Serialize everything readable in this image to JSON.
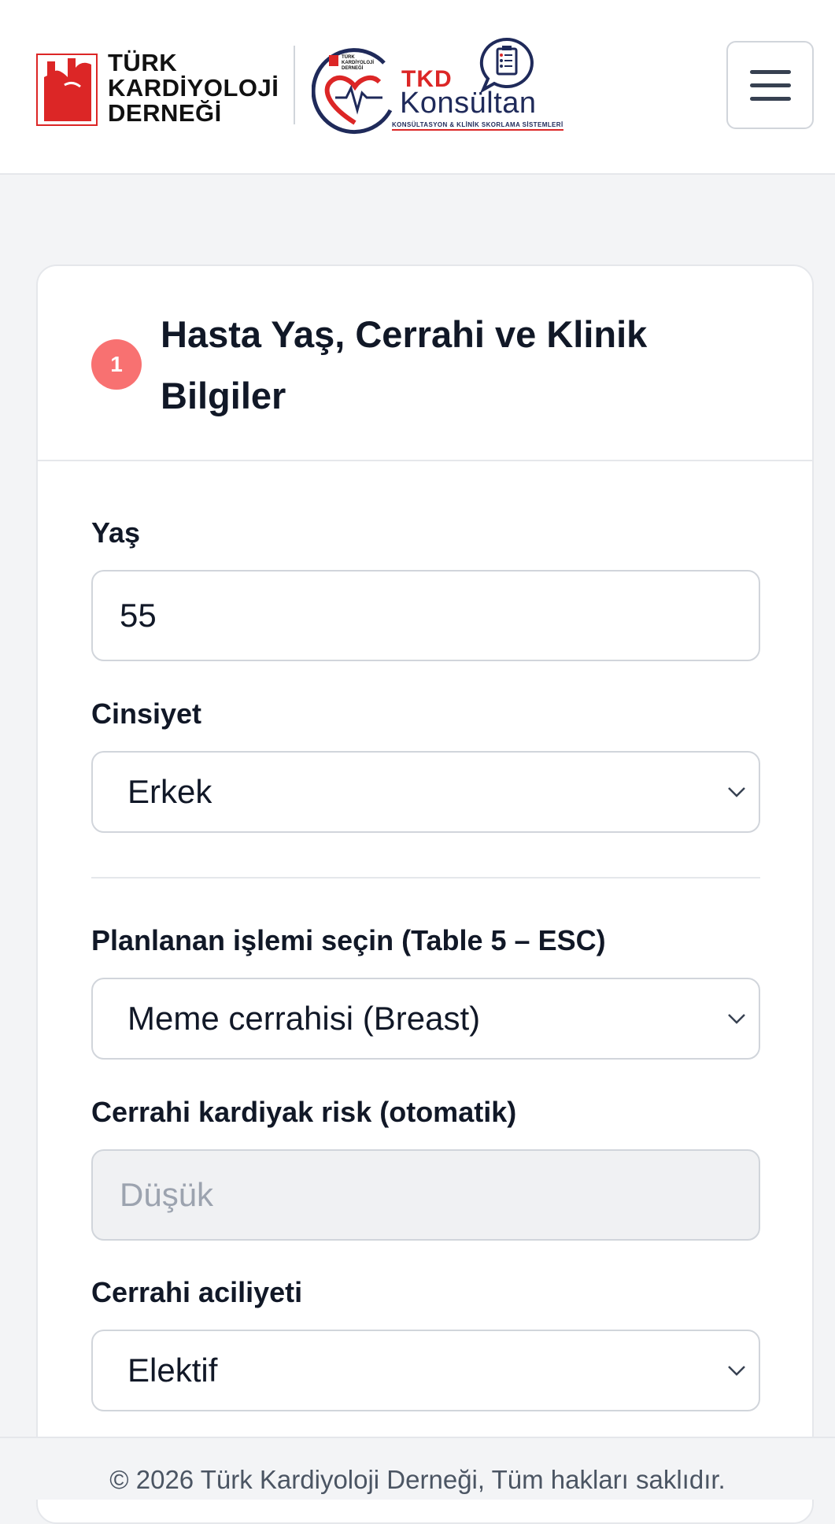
{
  "header": {
    "logo_tkd": {
      "line1": "TÜRK",
      "line2": "KARDİYOLOJİ",
      "line3": "DERNEĞİ"
    },
    "logo_konsultan": {
      "badge": "TKD",
      "name": "Konsültan",
      "tagline": "KONSÜLTASYON & KLİNİK SKORLAMA SİSTEMLERİ",
      "mini_line1": "TÜRK",
      "mini_line2": "KARDİYOLOJİ",
      "mini_line3": "DERNEĞİ"
    },
    "menu_icon": "hamburger-icon"
  },
  "card": {
    "step_number": "1",
    "title": "Hasta Yaş, Cerrahi ve Klinik Bilgiler",
    "fields": {
      "age": {
        "label": "Yaş",
        "value": "55"
      },
      "sex": {
        "label": "Cinsiyet",
        "value": "Erkek"
      },
      "procedure": {
        "label": "Planlanan işlemi seçin (Table 5 – ESC)",
        "value": "Meme cerrahisi (Breast)"
      },
      "cardiac_risk": {
        "label": "Cerrahi kardiyak risk (otomatik)",
        "placeholder": "Düşük"
      },
      "urgency": {
        "label": "Cerrahi aciliyeti",
        "value": "Elektif"
      }
    }
  },
  "footer": {
    "text": "© 2026 Türk Kardiyoloji Derneği, Tüm hakları saklıdır."
  },
  "colors": {
    "accent_red": "#dc2626",
    "badge_red": "#f87171",
    "navy": "#1f2a5a"
  }
}
